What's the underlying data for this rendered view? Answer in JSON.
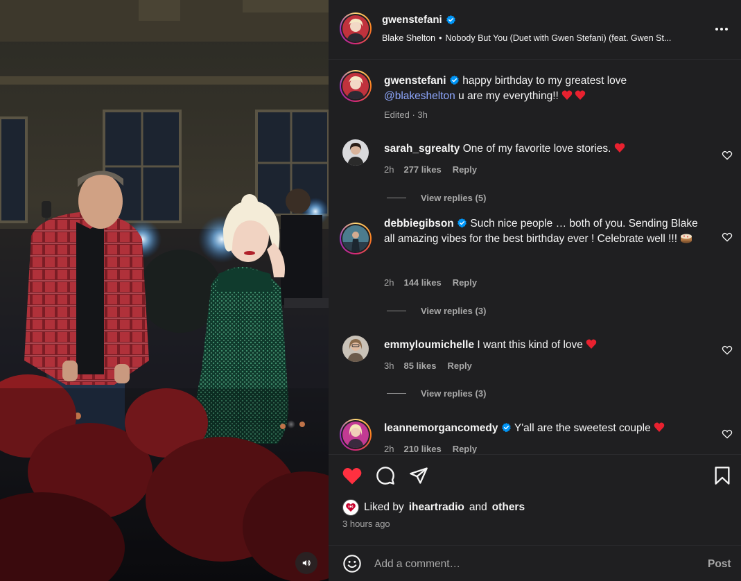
{
  "header": {
    "username": "gwenstefani",
    "audio": {
      "artist": "Blake Shelton",
      "title": "Nobody But You (Duet with Gwen Stefani) (feat. Gwen St..."
    }
  },
  "caption": {
    "username": "gwenstefani",
    "text_part1": "happy birthday to my greatest love",
    "mention": "@blakeshelton",
    "text_part2": "u are my everything!!",
    "meta": "Edited · 3h"
  },
  "comments": [
    {
      "username": "sarah_sgrealty",
      "text": "One of my favorite love stories.",
      "time": "2h",
      "likes": "277 likes",
      "reply": "Reply",
      "view_replies": "View replies (5)"
    },
    {
      "username": "debbiegibson",
      "text": "Such nice people … both of you. Sending Blake all amazing vibes for the best birthday ever ! Celebrate well !!!",
      "time": "2h",
      "likes": "144 likes",
      "reply": "Reply",
      "view_replies": "View replies (3)"
    },
    {
      "username": "emmyloumichelle",
      "text": "I want this kind of love",
      "time": "3h",
      "likes": "85 likes",
      "reply": "Reply",
      "view_replies": "View replies (3)"
    },
    {
      "username": "leannemorgancomedy",
      "text": "Y'all are the sweetest couple",
      "time": "2h",
      "likes": "210 likes",
      "reply": "Reply"
    }
  ],
  "liked_by": {
    "prefix": "Liked by",
    "user": "iheartradio",
    "and": "and",
    "others": "others"
  },
  "time_ago": "3 hours ago",
  "add_comment": {
    "placeholder": "Add a comment…",
    "post_label": "Post"
  },
  "icons": {
    "verified": "verified-badge-icon",
    "like_filled": "heart-filled-icon",
    "comment": "comment-bubble-icon",
    "share": "paper-plane-icon",
    "save": "bookmark-icon",
    "emoji": "smiley-icon",
    "more": "more-options-icon",
    "audio": "speaker-icon"
  },
  "colors": {
    "panel_bg": "#1f1f21",
    "heart_red": "#ff3040",
    "mention_blue": "#8fa8ff",
    "verified_blue": "#0095f6",
    "muted_text": "#a8a8a8"
  }
}
